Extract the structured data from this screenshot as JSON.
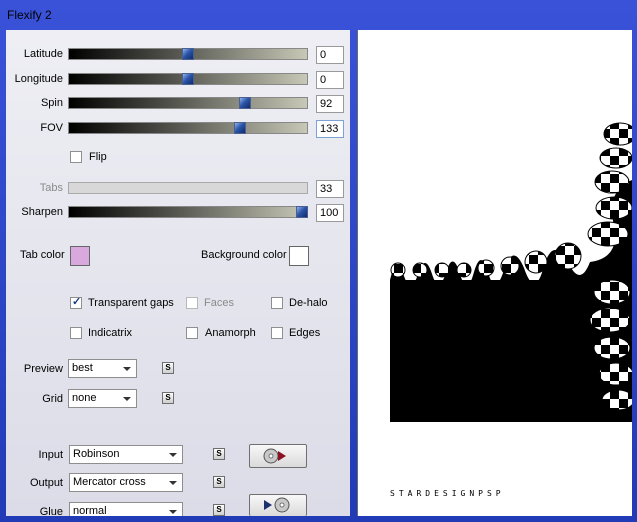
{
  "window": {
    "title": "Flexify 2"
  },
  "sliders": [
    {
      "label": "Latitude",
      "value": "0",
      "fraction": 0.5,
      "disabled": false
    },
    {
      "label": "Longitude",
      "value": "0",
      "fraction": 0.5,
      "disabled": false
    },
    {
      "label": "Spin",
      "value": "92",
      "fraction": 0.74,
      "disabled": false
    },
    {
      "label": "FOV",
      "value": "133",
      "fraction": 0.72,
      "disabled": false
    },
    {
      "label": "Tabs",
      "value": "33",
      "fraction": null,
      "disabled": true
    },
    {
      "label": "Sharpen",
      "value": "100",
      "fraction": 0.98,
      "disabled": false
    }
  ],
  "flip": {
    "label": "Flip",
    "checked": false
  },
  "colors": {
    "tab_color_label": "Tab color",
    "tab_color": "#d9a8dc",
    "background_color_label": "Background color",
    "background_color": "#ffffff"
  },
  "options": {
    "transparent_gaps": {
      "label": "Transparent gaps",
      "checked": true
    },
    "faces": {
      "label": "Faces",
      "checked": false,
      "disabled": true
    },
    "de_halo": {
      "label": "De-halo",
      "checked": false
    },
    "indicatrix": {
      "label": "Indicatrix",
      "checked": false
    },
    "anamorph": {
      "label": "Anamorph",
      "checked": false
    },
    "edges": {
      "label": "Edges",
      "checked": false
    }
  },
  "preview": {
    "label": "Preview",
    "value": "best"
  },
  "grid": {
    "label": "Grid",
    "value": "none"
  },
  "input": {
    "label": "Input",
    "value": "Robinson"
  },
  "output": {
    "label": "Output",
    "value": "Mercator cross"
  },
  "glue": {
    "label": "Glue",
    "value": "normal"
  },
  "lock_label": "S",
  "preview_image": {
    "watermark": "STARDESIGNPSP"
  },
  "accent": "#2b3fb8"
}
